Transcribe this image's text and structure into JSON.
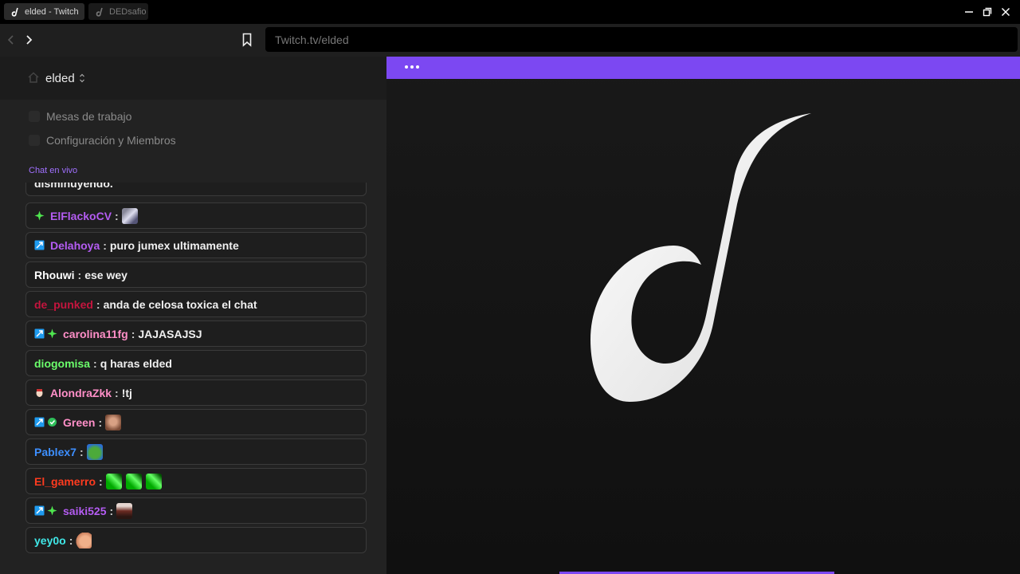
{
  "tabs": [
    {
      "label": "elded - Twitch",
      "active": true
    },
    {
      "label": "DEDsafio",
      "active": false
    }
  ],
  "address": {
    "url": "Twitch.tv/elded"
  },
  "sidebar": {
    "channel": "elded",
    "menu": [
      {
        "label": "Mesas de trabajo"
      },
      {
        "label": "Configuración y Miembros"
      }
    ],
    "chat_heading": "Chat en vivo"
  },
  "chat": [
    {
      "user": "",
      "text": "disminuyendo.",
      "color": "#ffffff"
    },
    {
      "user": "ElFlackoCV",
      "text": "",
      "color": "#b45cf2",
      "emotes": [
        "figure"
      ]
    },
    {
      "user": "Delahoya",
      "text": "puro jumex ultimamente",
      "color": "#b45cf2"
    },
    {
      "user": "Rhouwi",
      "text": "ese wey",
      "color": "#ffffff"
    },
    {
      "user": "de_punked",
      "text": "anda de celosa toxica el chat",
      "color": "#c4153e"
    },
    {
      "user": "carolina11fg",
      "text": "JAJASAJSJ",
      "color": "#ff8fc8"
    },
    {
      "user": "diogomisa",
      "text": "q haras elded",
      "color": "#6bff6b"
    },
    {
      "user": "AlondraZkk",
      "text": "!tj",
      "color": "#ff8fc8"
    },
    {
      "user": "Green",
      "text": "",
      "color": "#ff8fc8",
      "emotes": [
        "face"
      ]
    },
    {
      "user": "Pablex7",
      "text": "",
      "color": "#3d8fff",
      "emotes": [
        "pepe"
      ]
    },
    {
      "user": "El_gamerro",
      "text": "",
      "color": "#ff3b1f",
      "emotes": [
        "green",
        "green",
        "green"
      ]
    },
    {
      "user": "saiki525",
      "text": "",
      "color": "#b45cf2",
      "emotes": [
        "photo"
      ]
    },
    {
      "user": "yey0o",
      "text": "",
      "color": "#40e8e8",
      "emotes": [
        "hand"
      ]
    }
  ],
  "colors": {
    "accent": "#7c48f2",
    "chat_heading": "#a070ff"
  },
  "icons": {
    "back": "chevron-left-icon",
    "forward": "chevron-right-icon",
    "bookmark": "bookmark-icon",
    "home": "home-icon",
    "minimize": "minimize-icon",
    "restore": "restore-icon",
    "close": "close-icon",
    "more": "more-dots-icon"
  }
}
